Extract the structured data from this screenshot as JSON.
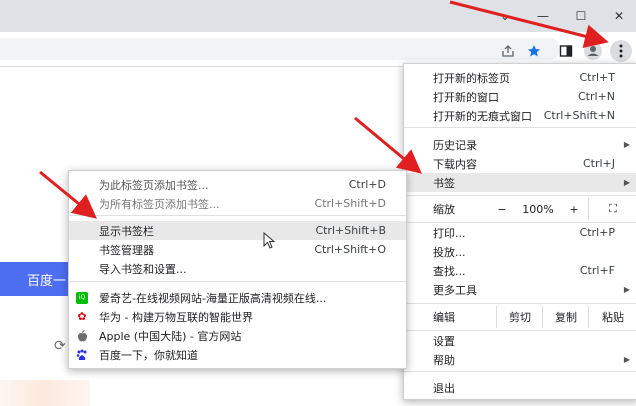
{
  "window": {
    "controls": {
      "minimize": "⌄",
      "restore": "—",
      "maximize": "☐",
      "close": "✕"
    }
  },
  "main_menu": {
    "items": [
      {
        "label": "打开新的标签页",
        "shortcut": "Ctrl+T"
      },
      {
        "label": "打开新的窗口",
        "shortcut": "Ctrl+N"
      },
      {
        "label": "打开新的无痕式窗口",
        "shortcut": "Ctrl+Shift+N"
      },
      {
        "label": "历史记录",
        "shortcut": ""
      },
      {
        "label": "下载内容",
        "shortcut": "Ctrl+J"
      },
      {
        "label": "书签",
        "shortcut": ""
      },
      {
        "label": "打印...",
        "shortcut": "Ctrl+P"
      },
      {
        "label": "投放...",
        "shortcut": ""
      },
      {
        "label": "查找...",
        "shortcut": "Ctrl+F"
      },
      {
        "label": "更多工具",
        "shortcut": ""
      },
      {
        "label": "设置",
        "shortcut": ""
      },
      {
        "label": "帮助",
        "shortcut": ""
      },
      {
        "label": "退出",
        "shortcut": ""
      }
    ],
    "zoom": {
      "label": "缩放",
      "minus": "−",
      "value": "100%",
      "plus": "+",
      "fullscreen": "⛶"
    },
    "edit": {
      "label": "编辑",
      "cut": "剪切",
      "copy": "复制",
      "paste": "粘贴"
    }
  },
  "bookmarks_menu": {
    "items": [
      {
        "label": "为此标签页添加书签...",
        "shortcut": "Ctrl+D"
      },
      {
        "label": "为所有标签页添加书签...",
        "shortcut": "Ctrl+Shift+D"
      },
      {
        "label": "显示书签栏",
        "shortcut": "Ctrl+Shift+B"
      },
      {
        "label": "书签管理器",
        "shortcut": "Ctrl+Shift+O"
      },
      {
        "label": "导入书签和设置...",
        "shortcut": ""
      }
    ],
    "bookmarks": [
      {
        "label": "爱奇艺-在线视频网站-海量正版高清视频在线...",
        "icon": "iqiyi-icon",
        "color": "#00be06"
      },
      {
        "label": "华为 - 构建万物互联的智能世界",
        "icon": "huawei-icon",
        "color": "#e60012"
      },
      {
        "label": "Apple (中国大陆) - 官方网站",
        "icon": "apple-icon",
        "color": "#555555"
      },
      {
        "label": "百度一下，你就知道",
        "icon": "baidu-icon",
        "color": "#2932e1"
      }
    ]
  },
  "page": {
    "baidu_button": "百度一"
  },
  "colors": {
    "annotation_arrow": "#e02020",
    "baidu_blue": "#4e6ef2",
    "highlight": "#e8e8e8"
  }
}
